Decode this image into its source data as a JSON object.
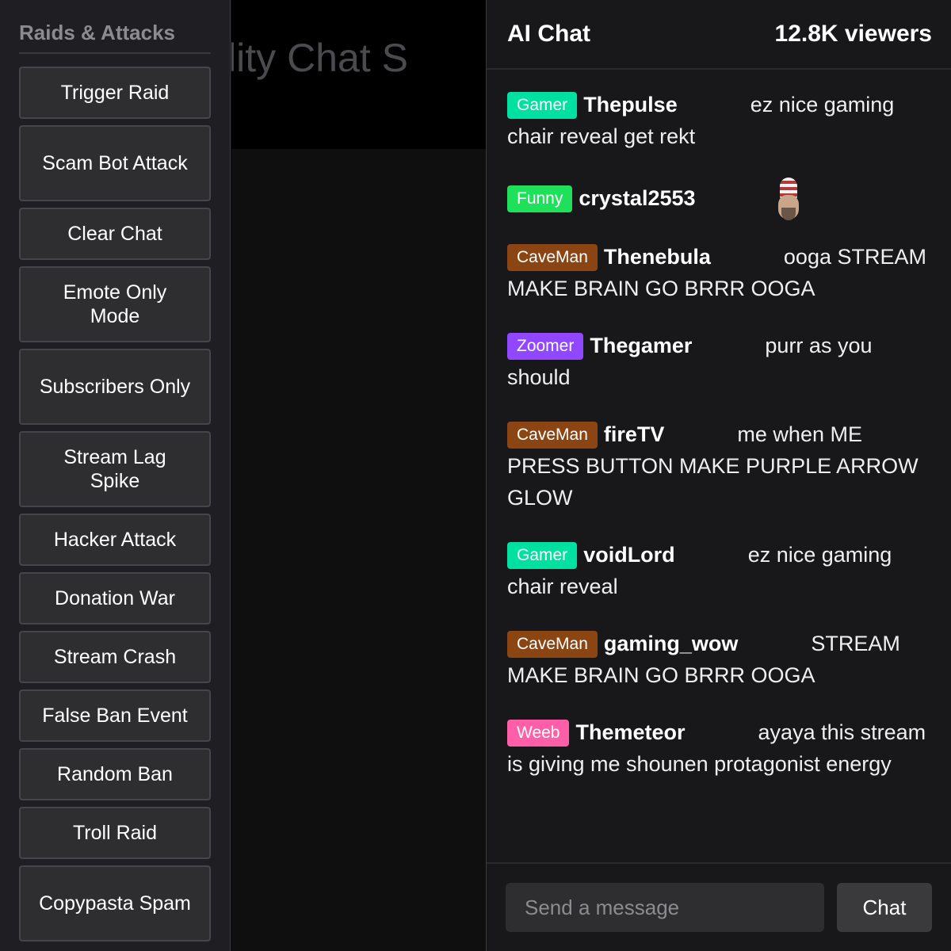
{
  "sidebar": {
    "title": "Raids & Attacks",
    "buttons": [
      {
        "label": "Trigger Raid"
      },
      {
        "label": "Scam Bot Attack"
      },
      {
        "label": "Clear Chat"
      },
      {
        "label": "Emote Only Mode"
      },
      {
        "label": "Subscribers Only"
      },
      {
        "label": "Stream Lag Spike"
      },
      {
        "label": "Hacker Attack"
      },
      {
        "label": "Donation War"
      },
      {
        "label": "Stream Crash"
      },
      {
        "label": "False Ban Event"
      },
      {
        "label": "Random Ban"
      },
      {
        "label": "Troll Raid"
      },
      {
        "label": "Copypasta Spam"
      }
    ]
  },
  "stream": {
    "title_visible": "rsonality Chat S"
  },
  "chat": {
    "title": "AI Chat",
    "viewers": "12.8K viewers",
    "messages": [
      {
        "badge": "Gamer",
        "badge_color": "#00e0a0",
        "user": "Thepulse",
        "text": "ez nice gaming chair reveal get rekt"
      },
      {
        "badge": "Funny",
        "badge_color": "#1fe05a",
        "user": "crystal2553",
        "text": "",
        "emote": "bearded-face-emote"
      },
      {
        "badge": "CaveMan",
        "badge_color": "#8b4513",
        "user": "Thenebula",
        "text": "ooga STREAM MAKE BRAIN GO BRRR OOGA"
      },
      {
        "badge": "Zoomer",
        "badge_color": "#9147ff",
        "user": "Thegamer",
        "text": "purr as you should"
      },
      {
        "badge": "CaveMan",
        "badge_color": "#8b4513",
        "user": "fireTV",
        "text": "me when ME PRESS BUTTON MAKE PURPLE ARROW GLOW"
      },
      {
        "badge": "Gamer",
        "badge_color": "#00e0a0",
        "user": "voidLord",
        "text": "ez nice gaming chair reveal"
      },
      {
        "badge": "CaveMan",
        "badge_color": "#8b4513",
        "user": "gaming_wow",
        "text": "STREAM MAKE BRAIN GO BRRR OOGA"
      },
      {
        "badge": "Weeb",
        "badge_color": "#ff5fa8",
        "user": "Themeteor",
        "text": "ayaya this stream is giving me shounen protagonist energy"
      }
    ],
    "input_placeholder": "Send a message",
    "send_label": "Chat"
  }
}
